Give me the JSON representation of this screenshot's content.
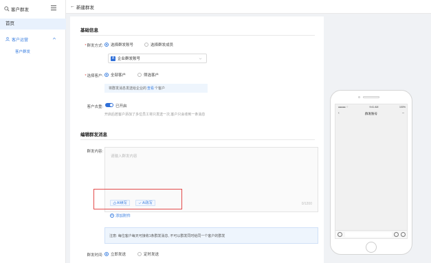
{
  "sidebar": {
    "search_text": "客户群发",
    "home_label": "首页",
    "group_label": "客户运营",
    "sub_item_label": "客户群发"
  },
  "header": {
    "back_arrow": "←",
    "title": "新建群发"
  },
  "basic_info": {
    "section_title": "基础信息",
    "send_mode": {
      "label": "群发方式:",
      "options": [
        "选择群发账号",
        "选择群发成员"
      ],
      "selected": 0
    },
    "account_select": {
      "icon_text": "A",
      "value": "企业群发账号"
    },
    "target_customers": {
      "label": "选择客户:",
      "options": [
        "全部客户",
        "筛选客户"
      ],
      "selected": 0
    },
    "info_prefix": "将群发消息发送给企业的",
    "info_highlight": "查看",
    "info_suffix": "个客户",
    "dedupe": {
      "label": "客户去重:",
      "toggle_on": true,
      "toggle_text": "已开启",
      "hint": "开启后若客户添加了多位员工将只发送一次,客户只会收到一条消息"
    }
  },
  "message": {
    "section_title": "编辑群发消息",
    "content_label": "群发内容:",
    "placeholder": "请输入群发内容",
    "counter": "0/1200",
    "ai_buttons": [
      "AI续写",
      "AI改写"
    ],
    "add_attachment": "添加附件",
    "notice": "注意: 每位客户每天可接收1条群发消息, 不可以群发同时给同一个客户的群发"
  },
  "send_time": {
    "label": "群发时间:",
    "options": [
      "立即发送",
      "定时发送"
    ],
    "selected": 0
  },
  "phone_preview": {
    "status_left": "●●●●● ⌔",
    "status_center": "9:41 AM",
    "status_right": "100%",
    "nav_back": "‹",
    "nav_title": "群发账号",
    "nav_more": "···"
  },
  "colors": {
    "accent": "#2f6fd8",
    "highlight_box": "#e34a4a",
    "info_bg": "#eef5fd"
  }
}
